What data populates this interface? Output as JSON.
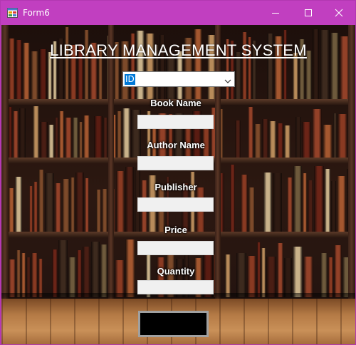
{
  "window": {
    "title": "Form6"
  },
  "main": {
    "heading": "LIBRARY  MANAGEMENT SYSTEM",
    "id_select": {
      "selected": "ID"
    },
    "fields": [
      {
        "label": "Book Name",
        "value": ""
      },
      {
        "label": "Author Name",
        "value": ""
      },
      {
        "label": "Publisher",
        "value": ""
      },
      {
        "label": "Price",
        "value": ""
      },
      {
        "label": "Quantity",
        "value": ""
      }
    ],
    "action_button": {
      "label": ""
    }
  },
  "colors": {
    "titlebar": "#c13fc0",
    "selection": "#0078d7",
    "field_bg": "#f0f0f0"
  },
  "icons": [
    "app-icon",
    "minimize-icon",
    "maximize-icon",
    "close-icon",
    "chevron-down-icon"
  ]
}
